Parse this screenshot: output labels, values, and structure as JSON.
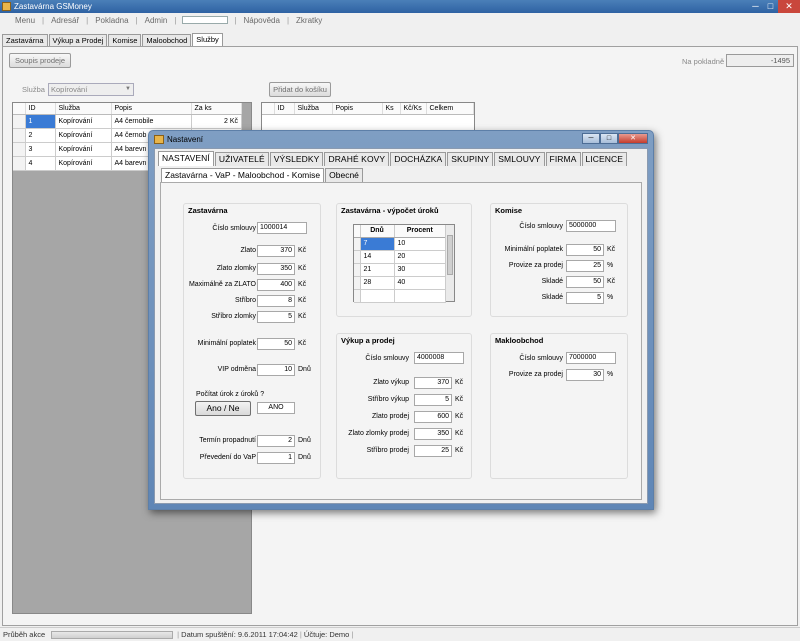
{
  "window": {
    "title": "Zastavárna GSMoney",
    "min": "─",
    "max": "□",
    "close": "✕"
  },
  "menu": [
    "Menu",
    "Adresář",
    "Pokladna",
    "Admin",
    "Nápověda",
    "Zkratky"
  ],
  "main_tabs": [
    "Zastavárna",
    "Výkup a Prodej",
    "Komise",
    "Maloobchod",
    "Služby"
  ],
  "services": {
    "summary_button": "Soupis prodeje",
    "register_label": "Na pokladně",
    "register_value": "-1495",
    "service_label": "Služba",
    "service_value": "Kopírování",
    "add_to_cart_button": "Přidat do košíku",
    "left_grid": {
      "columns": [
        "ID",
        "Služba",
        "Popis",
        "Za ks"
      ],
      "rows": [
        [
          "1",
          "Kopírování",
          "A4 černobile",
          "2 Kč"
        ],
        [
          "2",
          "Kopírování",
          "A4 černob",
          ""
        ],
        [
          "3",
          "Kopírování",
          "A4 barevn",
          ""
        ],
        [
          "4",
          "Kopírování",
          "A4 barevn",
          ""
        ]
      ]
    },
    "right_grid": {
      "columns": [
        "ID",
        "Služba",
        "Popis",
        "Ks",
        "Kč/Ks",
        "Celkem"
      ]
    }
  },
  "status": {
    "progress_label": "Průběh akce",
    "started": "Datum spuštění:  9.6.2011 17:04:42",
    "account": "Účtuje:  Demo"
  },
  "dialog": {
    "title": "Nastavení",
    "min": "─",
    "max": "□",
    "close": "✕",
    "tabs": [
      "NASTAVENÍ",
      "UŽIVATELÉ",
      "VÝSLEDKY",
      "DRAHÉ KOVY",
      "DOCHÁZKA",
      "SKUPINY",
      "SMLOUVY",
      "FIRMA",
      "LICENCE"
    ],
    "subtabs": [
      "Zastavárna - VaP - Maloobchod - Komise",
      "Obecné"
    ],
    "zastavarna": {
      "title": "Zastavárna",
      "contract_label": "Číslo smlouvy",
      "contract_value": "1000014",
      "fields": [
        {
          "label": "Zlato",
          "value": "370",
          "unit": "Kč"
        },
        {
          "label": "Zlato zlomky",
          "value": "350",
          "unit": "Kč"
        },
        {
          "label": "Maximálně za ZLATO",
          "value": "400",
          "unit": "Kč"
        },
        {
          "label": "Stříbro",
          "value": "8",
          "unit": "Kč"
        },
        {
          "label": "Stříbro zlomky",
          "value": "5",
          "unit": "Kč"
        },
        {
          "label": "Minimální poplatek",
          "value": "50",
          "unit": "Kč"
        },
        {
          "label": "VIP odměna",
          "value": "10",
          "unit": "Dnů"
        }
      ],
      "interest_question": "Počítat úrok z úroků ?",
      "yes_no_button": "Ano / Ne",
      "interest_value": "ANO",
      "expiry_label": "Termín propadnutí",
      "expiry_value": "2",
      "expiry_unit": "Dnů",
      "transfer_label": "Převedení do VaP",
      "transfer_value": "1",
      "transfer_unit": "Dnů"
    },
    "interest": {
      "title": "Zastavárna - výpočet úroků",
      "columns": [
        "Dnů",
        "Procent"
      ],
      "rows": [
        [
          "7",
          "10"
        ],
        [
          "14",
          "20"
        ],
        [
          "21",
          "30"
        ],
        [
          "28",
          "40"
        ]
      ]
    },
    "vykup": {
      "title": "Výkup a prodej",
      "contract_label": "Číslo smlouvy",
      "contract_value": "4000008",
      "fields": [
        {
          "label": "Zlato výkup",
          "value": "370",
          "unit": "Kč"
        },
        {
          "label": "Stříbro výkup",
          "value": "5",
          "unit": "Kč"
        },
        {
          "label": "Zlato prodej",
          "value": "600",
          "unit": "Kč"
        },
        {
          "label": "Zlato zlomky prodej",
          "value": "350",
          "unit": "Kč"
        },
        {
          "label": "Stříbro prodej",
          "value": "25",
          "unit": "Kč"
        }
      ]
    },
    "komise": {
      "title": "Komise",
      "contract_label": "Číslo smlouvy",
      "contract_value": "5000000",
      "fields": [
        {
          "label": "Minimální poplatek",
          "value": "50",
          "unit": "Kč"
        },
        {
          "label": "Provize za prodej",
          "value": "25",
          "unit": "%"
        },
        {
          "label": "Skladé",
          "value": "50",
          "unit": "Kč"
        },
        {
          "label": "Skladé",
          "value": "5",
          "unit": "%"
        }
      ]
    },
    "maloobchod": {
      "title": "Makloobchod",
      "contract_label": "Číslo smlouvy",
      "contract_value": "7000000",
      "fields": [
        {
          "label": "Provize za prodej",
          "value": "30",
          "unit": "%"
        }
      ]
    }
  }
}
